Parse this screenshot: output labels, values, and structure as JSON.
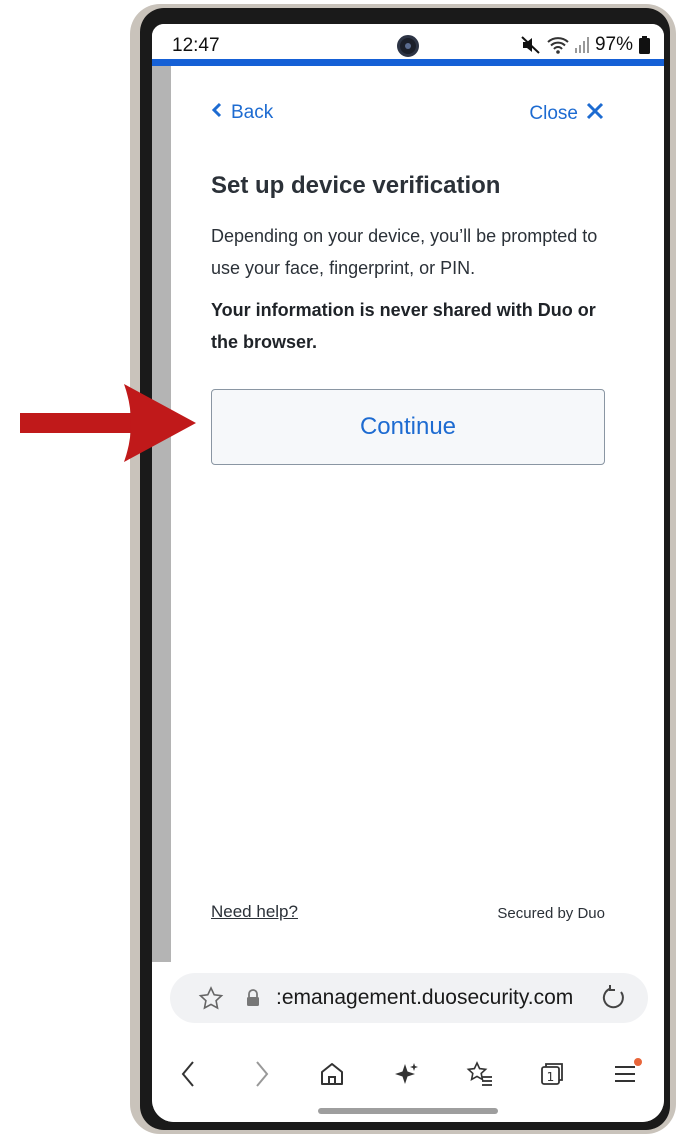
{
  "status_bar": {
    "time": "12:47",
    "battery": "97%"
  },
  "header": {
    "back_label": "Back",
    "close_label": "Close"
  },
  "main": {
    "title": "Set up device verification",
    "description": "Depending on your device, you’ll be prompted to use your face, fingerprint, or PIN.",
    "privacy_note": "Your information is never shared with Duo or the browser.",
    "continue_label": "Continue"
  },
  "footer": {
    "help_label": "Need help?",
    "secured_label": "Secured by Duo"
  },
  "browser": {
    "url": ":emanagement.duosecurity.com",
    "tab_count": "1"
  },
  "colors": {
    "link_blue": "#1d6bd1",
    "accent_bar": "#1560d6",
    "annotation_arrow": "#c0191a"
  },
  "icons": {
    "back": "chevron-left-icon",
    "close": "close-x-icon",
    "bookmark_star": "star-icon",
    "lock": "lock-icon",
    "reload": "reload-icon",
    "nav": [
      "back-arrow-icon",
      "forward-arrow-icon",
      "home-icon",
      "sparkle-ai-icon",
      "bookmarks-icon",
      "tabs-icon",
      "menu-icon"
    ]
  }
}
